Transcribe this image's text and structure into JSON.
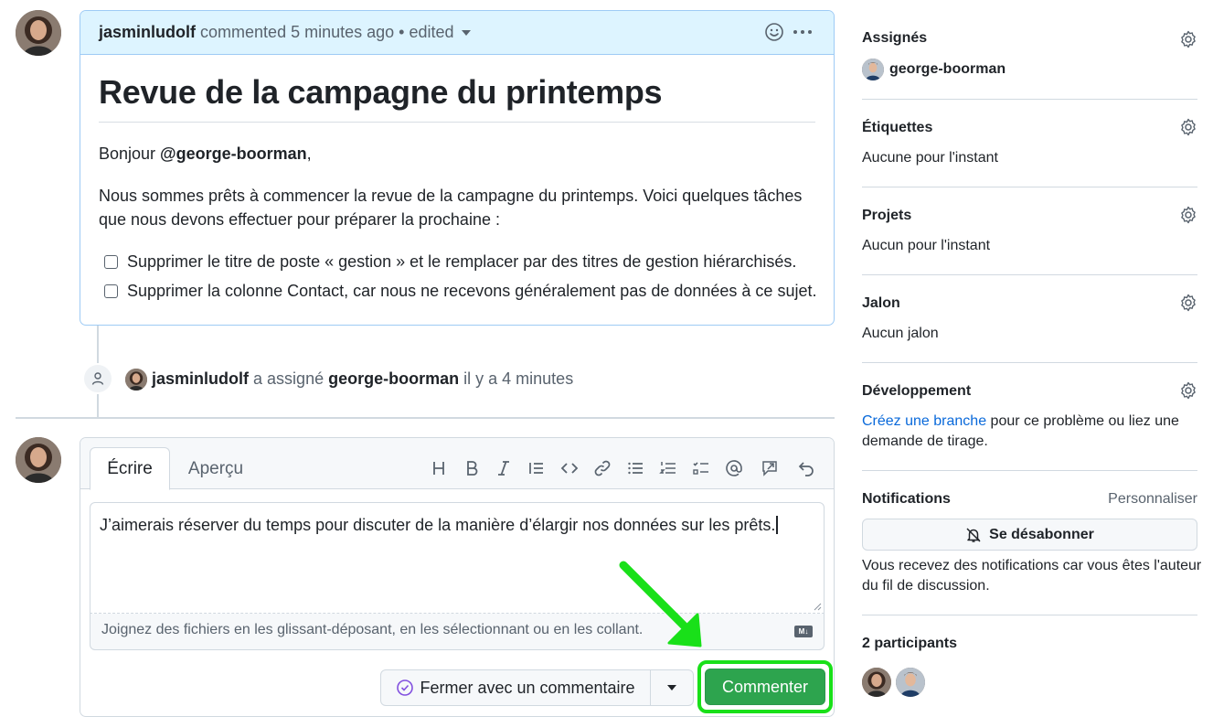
{
  "comment": {
    "author": "jasminludolf",
    "meta": "commented 5 minutes ago",
    "edited": "edited",
    "title": "Revue de la campagne du printemps",
    "greeting_prefix": "Bonjour ",
    "greeting_mention": "@george-boorman",
    "greeting_suffix": ",",
    "para_line1": "Nous sommes prêts à commencer la revue de la campagne du printemps. Voici quelques tâches",
    "para_line2": "que nous devons effectuer pour préparer la prochaine :",
    "tasks": [
      "Supprimer le titre de poste « gestion » et le remplacer par des titres de gestion hiérarchisés.",
      "Supprimer la colonne Contact, car nous ne recevons généralement pas de données à ce sujet."
    ]
  },
  "timeline_event": {
    "actor": "jasminludolf",
    "action": "a assigné",
    "target": "george-boorman",
    "time": "il y a 4 minutes"
  },
  "editor": {
    "tab_write": "Écrire",
    "tab_preview": "Aperçu",
    "toolbar_icons": [
      "heading-icon",
      "bold-icon",
      "italic-icon",
      "quote-icon",
      "code-icon",
      "link-icon",
      "unordered-list-icon",
      "ordered-list-icon",
      "task-list-icon",
      "mention-icon",
      "reference-icon",
      "undo-icon"
    ],
    "text": "J’aimerais réserver du temps pour discuter de la manière d’élargir nos données sur les prêts.",
    "attach_hint": "Joignez des fichiers en les glissant-déposant, en les sélectionnant ou en les collant.",
    "close_label": "Fermer avec un commentaire",
    "comment_label": "Commenter"
  },
  "sidebar": {
    "assignees": {
      "title": "Assignés",
      "value": "george-boorman"
    },
    "labels": {
      "title": "Étiquettes",
      "value": "Aucune pour l'instant"
    },
    "projects": {
      "title": "Projets",
      "value": "Aucun pour l'instant"
    },
    "milestone": {
      "title": "Jalon",
      "value": "Aucun jalon"
    },
    "development": {
      "title": "Développement",
      "link": "Créez une branche",
      "text1": " pour ce problème ou liez une",
      "text2": "demande de tirage."
    },
    "notifications": {
      "title": "Notifications",
      "customize": "Personnaliser",
      "button": "Se désabonner",
      "text1": "Vous recevez des notifications car vous êtes l'auteur",
      "text2": "du fil de discussion."
    },
    "participants": {
      "title": "2 participants"
    }
  },
  "colors": {
    "accent_green": "#2da44e",
    "highlight_green": "#19e019",
    "link_blue": "#0969da",
    "header_blue": "#ddf4ff"
  }
}
